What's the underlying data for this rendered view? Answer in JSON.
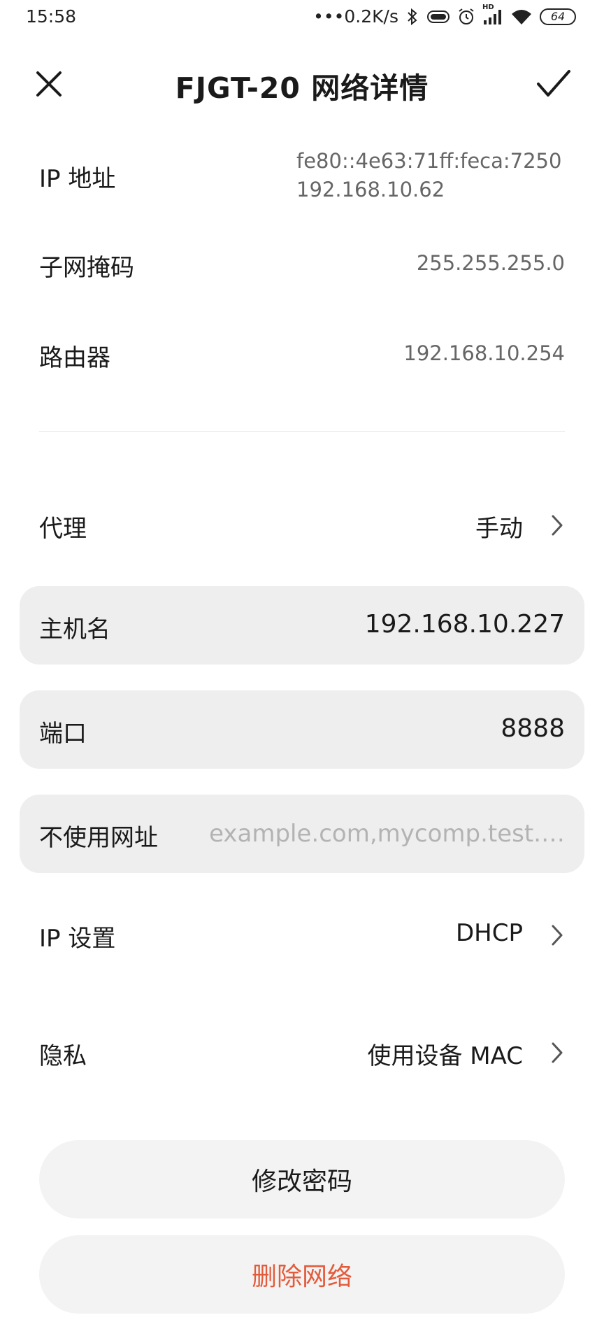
{
  "status_bar": {
    "time": "15:58",
    "net_speed": "•••0.2K/s",
    "battery": "64",
    "hd_badge": "HD",
    "icons": [
      "bluetooth-icon",
      "vibrate-icon",
      "alarm-icon",
      "signal-icon",
      "wifi-icon",
      "battery-icon"
    ]
  },
  "header": {
    "title": "FJGT-20 网络详情",
    "close_icon": "close-icon",
    "confirm_icon": "check-icon"
  },
  "info": {
    "ip_label": "IP 地址",
    "ip_values": [
      "fe80::4e63:71ff:feca:7250",
      "192.168.10.62"
    ],
    "subnet_label": "子网掩码",
    "subnet_value": "255.255.255.0",
    "router_label": "路由器",
    "router_value": "192.168.10.254"
  },
  "proxy": {
    "label": "代理",
    "value": "手动"
  },
  "proxy_fields": {
    "hostname_label": "主机名",
    "hostname_value": "192.168.10.227",
    "port_label": "端口",
    "port_value": "8888",
    "bypass_label": "不使用网址",
    "bypass_placeholder": "example.com,mycomp.test.…"
  },
  "ip_settings": {
    "label": "IP 设置",
    "value": "DHCP"
  },
  "privacy": {
    "label": "隐私",
    "value": "使用设备 MAC"
  },
  "actions": {
    "change_password": "修改密码",
    "delete_network": "删除网络"
  },
  "colors": {
    "danger": "#e35b3b",
    "field_bg": "#eeeeee",
    "button_bg": "#f3f3f3"
  }
}
